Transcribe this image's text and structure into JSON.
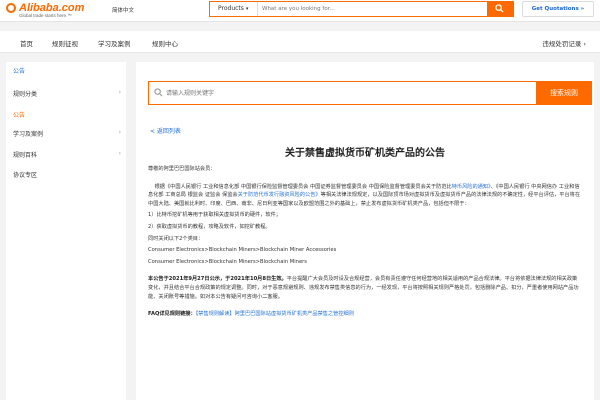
{
  "header": {
    "logo_text": "Alibaba.com",
    "logo_tagline": "Global trade starts here.™",
    "language": "简体中文",
    "search_category": "Products",
    "search_placeholder": "What are you looking for...",
    "quote_button": "Get Quotations »"
  },
  "nav": {
    "items": [
      "首页",
      "规则征视",
      "学习及案例",
      "规则中心"
    ],
    "right": "违规处罚记录 ›"
  },
  "sidebar": {
    "header": "公告",
    "items": [
      {
        "label": "规则分类",
        "arrow": "›"
      },
      {
        "label": "公告",
        "active": true
      },
      {
        "label": "学习及案例",
        "arrow": "›"
      },
      {
        "label": "规则百科",
        "arrow": "›"
      },
      {
        "label": "协议专区",
        "arrow": ""
      }
    ]
  },
  "rule_search": {
    "placeholder": "请输入规则关键字",
    "button": "搜索规则"
  },
  "article": {
    "back_link": "< 返回列表",
    "title": "关于禁售虚拟货币矿机类产品的公告",
    "greeting": "尊敬的阿里巴巴国际站会员：",
    "para1_a": "根据《中国人民银行 工业和信息化部 中国银行保险监督管理委员会 中国证券监督管理委员会 中国保险监督管理委员会关于防范比",
    "para1_link1": "特币风险的通知》",
    "para1_b": "、《中国人民银行 中央网信办 工业和信息化部 工商总局 银监会 证监会 保监会",
    "para1_link2": "关于防范代币发行融资风险的公告》",
    "para1_c": "等相关法律法规规定，以及国际顶市场对虚拟货币及虚拟货币产品的法律法规的不确定性，经平台评估，平台将在中国大陆、美国就比利时、印度、巴西、南非、尼日利亚等国家以及欧盟范围之外的基础上，禁止发布虚拟货币矿机类产品，包括但不限于：",
    "item1": "1）比特币挖矿机等用于获取相关虚拟货币的硬件，软件；",
    "item2": "2）获取虚拟货币的教程，攻略及软件，如挖矿教程。",
    "cat_header": "同时关闭以下2个类目：",
    "cat1": "Consumer Electronics>Blockchain Miners>Blockchain Miner Accessories",
    "cat2": "Consumer Electronics>Blockchain Miners>Blockchain Miners",
    "para2_bold": "本公告于2021年9月27日公示，于2021年10月8日生效。",
    "para2_rest": "平台提醒广大会员及时设及合规经营，会员有责任遵守任何经营地的相关适用的产品合规法律。平台将依据法律法规的相关政策变化，并且结合平台合规政策的规定调整。同时，对于恶意规避规则、违规发布禁售类信息的行为，一经发现，平台将按照相关规则严格处罚，包括删除产品、扣分，严重者使用网站产品功能、关闭账号等措施。如对本公告有疑问可咨询小二客服。",
    "faq_label": "FAQ详见规则链接：",
    "faq_link": "【禁售规则解读】阿里巴巴国际站虚拟货币矿机类产品禁售之管控细则"
  },
  "colors": {
    "brand": "#ff6a00",
    "link": "#1f6fd8"
  }
}
